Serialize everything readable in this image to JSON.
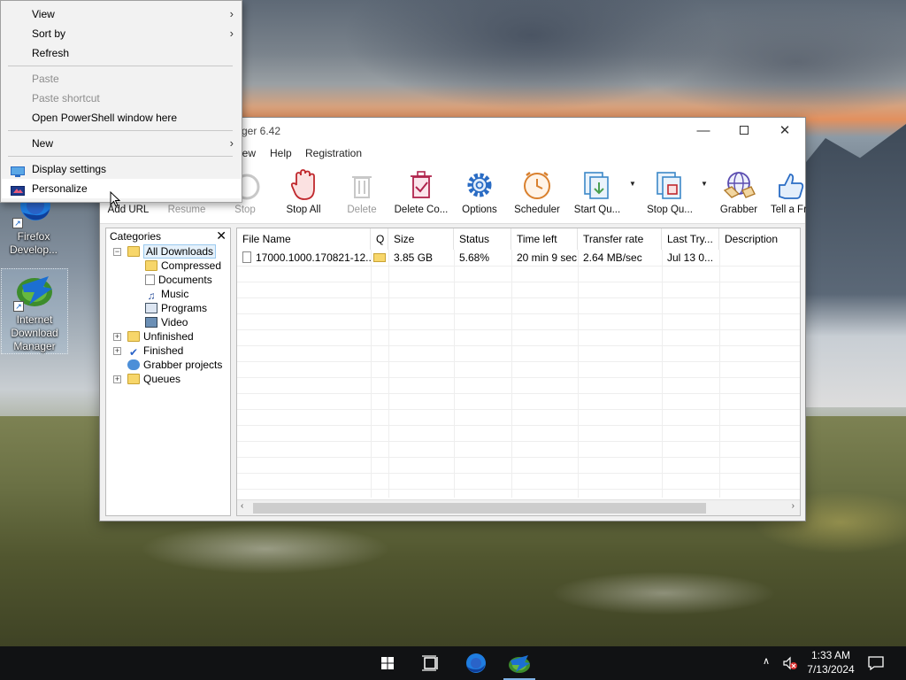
{
  "context_menu": {
    "items": [
      {
        "label": "View",
        "submenu": true,
        "disabled": false
      },
      {
        "label": "Sort by",
        "submenu": true,
        "disabled": false
      },
      {
        "label": "Refresh",
        "submenu": false,
        "disabled": false
      },
      {
        "label": "Paste",
        "submenu": false,
        "disabled": true
      },
      {
        "label": "Paste shortcut",
        "submenu": false,
        "disabled": true
      },
      {
        "label": "Open PowerShell window here",
        "submenu": false,
        "disabled": false
      },
      {
        "label": "New",
        "submenu": true,
        "disabled": false
      },
      {
        "label": "Display settings",
        "submenu": false,
        "disabled": false,
        "icon": "display-icon"
      },
      {
        "label": "Personalize",
        "submenu": false,
        "disabled": false,
        "icon": "personalize-icon",
        "hover": true
      }
    ],
    "submenu_glyph": "›"
  },
  "desktop": {
    "icons": [
      {
        "name": "firefox-developer-shortcut",
        "label": "Firefox Develop...",
        "icon": "firefox-icon"
      },
      {
        "name": "idm-shortcut",
        "label": "Internet Download Manager",
        "icon": "idm-icon",
        "selected": true
      }
    ]
  },
  "idm": {
    "title": "ger 6.42",
    "menu": {
      "view": "iew",
      "help": "Help",
      "registration": "Registration"
    },
    "toolbar": [
      {
        "label": "Add URL",
        "icon": "add-url-icon",
        "disabled": false
      },
      {
        "label": "Resume",
        "icon": "resume-icon",
        "disabled": true
      },
      {
        "label": "Stop",
        "icon": "stop-icon",
        "disabled": true
      },
      {
        "label": "Stop All",
        "icon": "stop-all-hand-icon",
        "disabled": false
      },
      {
        "label": "Delete",
        "icon": "delete-icon",
        "disabled": true
      },
      {
        "label": "Delete Co...",
        "icon": "delete-completed-icon",
        "disabled": false
      },
      {
        "label": "Options",
        "icon": "options-gear-icon",
        "disabled": false
      },
      {
        "label": "Scheduler",
        "icon": "scheduler-clock-icon",
        "disabled": false
      },
      {
        "label": "Start Qu...",
        "icon": "start-queue-icon",
        "disabled": false
      },
      {
        "label": "Stop Qu...",
        "icon": "stop-queue-icon",
        "disabled": false
      },
      {
        "label": "Grabber",
        "icon": "grabber-icon",
        "disabled": false
      },
      {
        "label": "Tell a Fri",
        "icon": "tell-friend-icon",
        "disabled": false
      }
    ],
    "categories": {
      "header": "Categories",
      "close": "✕",
      "tree": [
        {
          "label": "All Downloads",
          "level": 0,
          "expander": "−",
          "selected": true
        },
        {
          "label": "Compressed",
          "level": 1
        },
        {
          "label": "Documents",
          "level": 1
        },
        {
          "label": "Music",
          "level": 1
        },
        {
          "label": "Programs",
          "level": 1
        },
        {
          "label": "Video",
          "level": 1
        },
        {
          "label": "Unfinished",
          "level": 0,
          "expander": "+"
        },
        {
          "label": "Finished",
          "level": 0,
          "expander": "+"
        },
        {
          "label": "Grabber projects",
          "level": 0
        },
        {
          "label": "Queues",
          "level": 0,
          "expander": "+"
        }
      ]
    },
    "list": {
      "columns": [
        "File Name",
        "Q",
        "Size",
        "Status",
        "Time left",
        "Transfer rate",
        "Last Try...",
        "Description"
      ],
      "rows": [
        {
          "file_name": "17000.1000.170821-12...",
          "q": "",
          "size": "3.85  GB",
          "status": "5.68%",
          "time_left": "20 min 9 sec",
          "transfer_rate": "2.64  MB/sec",
          "last_try": "Jul 13 0...",
          "description": ""
        }
      ],
      "scroll_left": "‹",
      "scroll_right": "›"
    }
  },
  "window_controls": {
    "minimize": "—",
    "close": "✕"
  },
  "taskbar": {
    "tray_chevron": "∧",
    "time": "1:33 AM",
    "date": "7/13/2024"
  }
}
